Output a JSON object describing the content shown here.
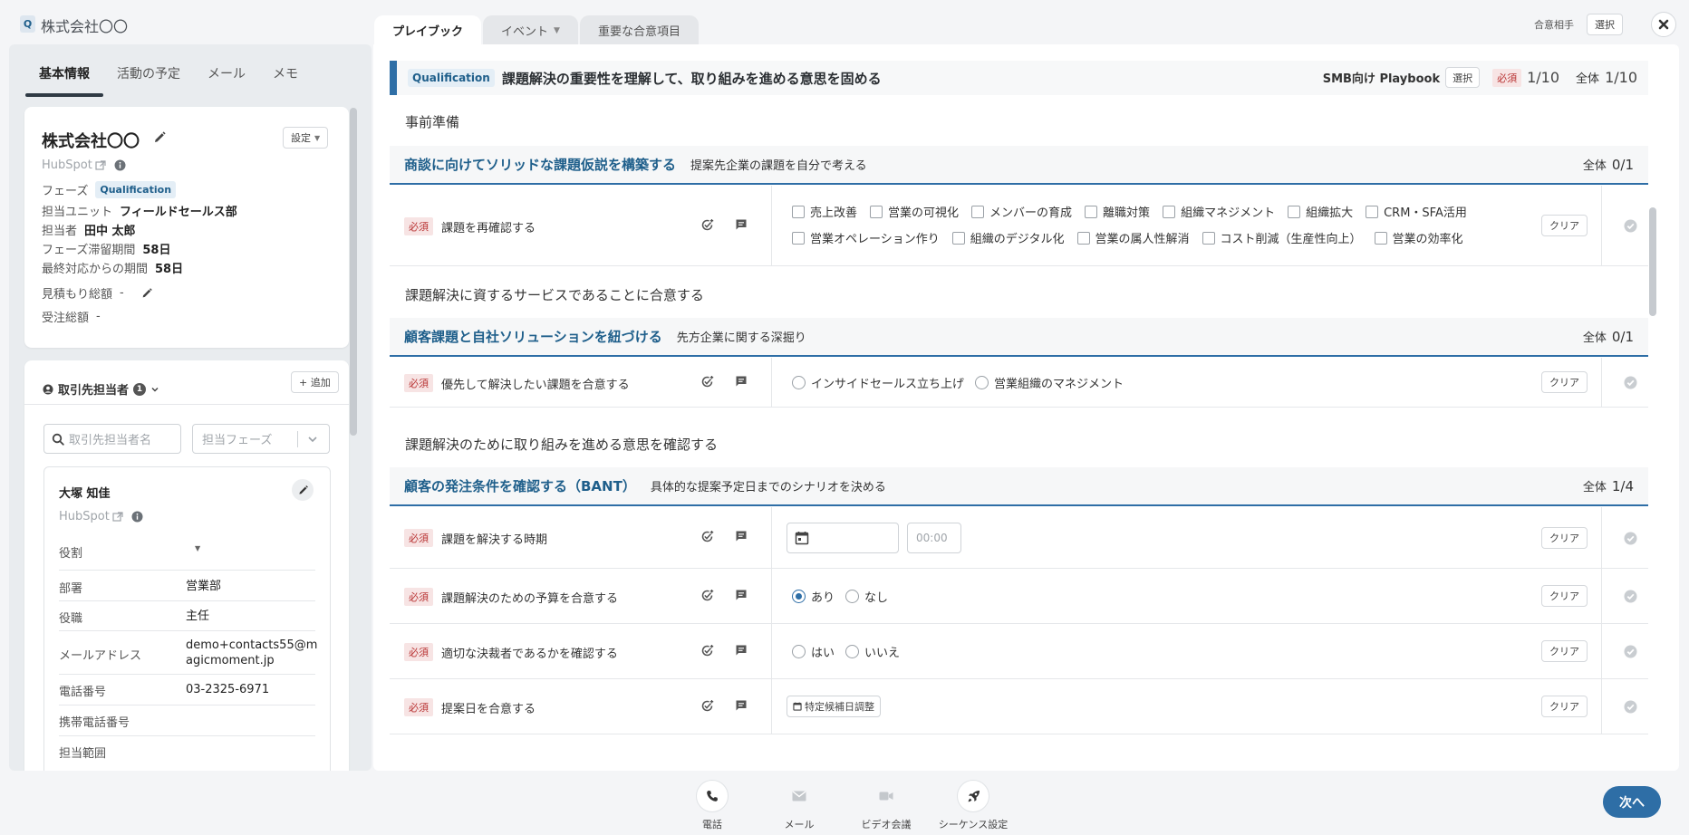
{
  "app": {
    "logo_letter": "Q",
    "title": "株式会社〇〇"
  },
  "main_tabs": [
    {
      "label": "プレイブック",
      "active": true
    },
    {
      "label": "イベント",
      "has_caret": true
    },
    {
      "label": "重要な合意項目"
    }
  ],
  "header_right": {
    "partner_label": "合意相手",
    "select_label": "選択"
  },
  "left_tabs": [
    "基本情報",
    "活動の予定",
    "メール",
    "メモ"
  ],
  "company": {
    "name": "株式会社〇〇",
    "settings_label": "設定",
    "hubspot_label": "HubSpot",
    "phase_label": "フェーズ",
    "phase_value": "Qualification",
    "unit_label": "担当ユニット",
    "unit_value": "フィールドセールス部",
    "owner_label": "担当者",
    "owner_value": "田中 太郎",
    "stay_label": "フェーズ滞留期間",
    "stay_value": "58日",
    "last_label": "最終対応からの期間",
    "last_value": "58日",
    "estimate_label": "見積もり総額",
    "estimate_value": "-",
    "order_label": "受注総額",
    "order_value": "-"
  },
  "contacts": {
    "title": "取引先担当者",
    "count": "1",
    "add_label": "+ 追加",
    "search_placeholder": "取引先担当者名",
    "phase_placeholder": "担当フェーズ",
    "person": {
      "name": "大塚 知佳",
      "hubspot_label": "HubSpot",
      "role_label": "役割",
      "fields": [
        {
          "label": "部署",
          "value": "営業部"
        },
        {
          "label": "役職",
          "value": "主任"
        },
        {
          "label": "メールアドレス",
          "value_line1": "demo+contacts55@m",
          "value_line2": "agicmoment.jp"
        },
        {
          "label": "電話番号",
          "value": "03-2325-6971"
        },
        {
          "label": "携帯電話番号",
          "value": ""
        },
        {
          "label": "担当範囲",
          "value": ""
        }
      ]
    }
  },
  "playbook": {
    "badge": "Qualification",
    "title": "課題解決の重要性を理解して、取り組みを進める意思を固める",
    "name": "SMB向け Playbook",
    "select_label": "選択",
    "required_label": "必須",
    "required_progress": "1/10",
    "total_label": "全体",
    "total_progress": "1/10",
    "clear_label": "クリア",
    "stages": [
      {
        "title": "事前準備"
      },
      {
        "title": "課題解決に資するサービスであることに合意する"
      },
      {
        "title": "課題解決のために取り組みを進める意思を確認する"
      }
    ],
    "sections": [
      {
        "title": "商談に向けてソリッドな課題仮説を構築する",
        "subtitle": "提案先企業の課題を自分で考える",
        "total_label": "全体",
        "progress": "0/1"
      },
      {
        "title": "顧客課題と自社ソリューションを紐づける",
        "subtitle": "先方企業に関する深掘り",
        "total_label": "全体",
        "progress": "0/1"
      },
      {
        "title": "顧客の発注条件を確認する（BANT）",
        "subtitle": "具体的な提案予定日までのシナリオを決める",
        "total_label": "全体",
        "progress": "1/4"
      }
    ],
    "tasks": [
      {
        "name": "課題を再確認する",
        "options_row1": [
          "売上改善",
          "営業の可視化",
          "メンバーの育成",
          "離職対策",
          "組織マネジメント",
          "組織拡大",
          "CRM・SFA活用"
        ],
        "options_row2": [
          "営業オペレーション作り",
          "組織のデジタル化",
          "営業の属人性解消",
          "コスト削減（生産性向上）",
          "営業の効率化"
        ]
      },
      {
        "name": "優先して解決したい課題を合意する",
        "options": [
          "インサイドセールス立ち上げ",
          "営業組織のマネジメント"
        ]
      },
      {
        "name": "課題を解決する時期",
        "time_placeholder": "00:00"
      },
      {
        "name": "課題解決のための予算を合意する",
        "options": [
          "あり",
          "なし"
        ],
        "selected": "あり"
      },
      {
        "name": "適切な決裁者であるかを確認する",
        "options": [
          "はい",
          "いいえ"
        ]
      },
      {
        "name": "提案日を合意する",
        "schedule_label": "特定候補日調整"
      }
    ]
  },
  "bottom": {
    "actions": [
      {
        "label": "電話",
        "icon": "phone-icon"
      },
      {
        "label": "メール",
        "icon": "mail-icon"
      },
      {
        "label": "ビデオ会議",
        "icon": "video-icon"
      },
      {
        "label": "シーケンス設定",
        "icon": "rocket-icon"
      }
    ],
    "next_label": "次へ"
  },
  "colors": {
    "accent": "#2e6ea6",
    "required": "#b83232",
    "phase_badge_bg": "#e4eef6"
  }
}
